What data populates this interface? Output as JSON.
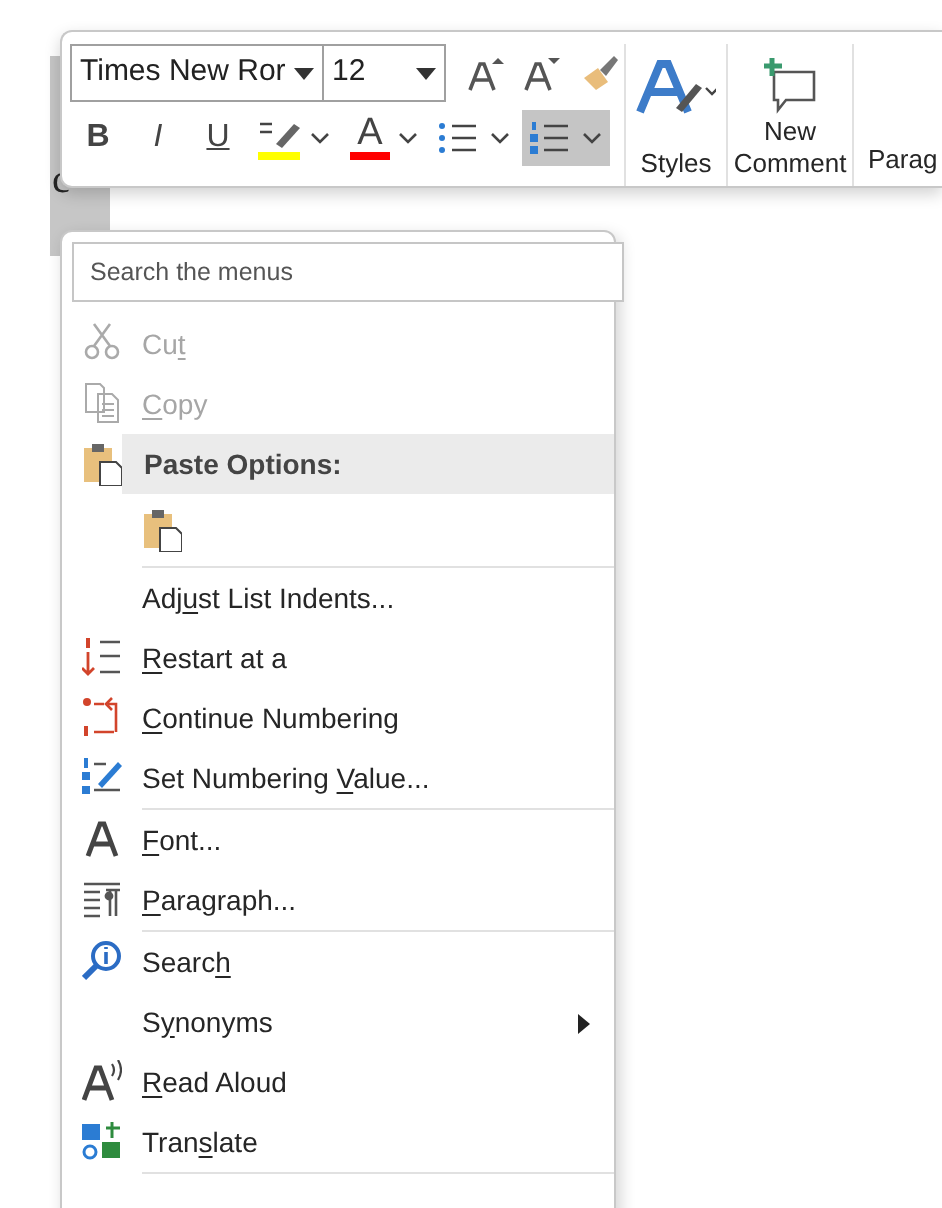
{
  "document": {
    "lines": [
      {
        "selected": true
      },
      {
        "selected": true
      },
      {
        "text": "c",
        "selected": true
      },
      {
        "selected": true
      }
    ]
  },
  "mini_toolbar": {
    "font_name": "Times New Ror",
    "font_size": "12",
    "format_buttons": [
      {
        "kind": "bold",
        "label": "B"
      },
      {
        "kind": "italic",
        "label": "I"
      },
      {
        "kind": "underline",
        "label": "U"
      },
      {
        "kind": "highlight",
        "color": "#ffff00"
      },
      {
        "kind": "font-color",
        "label": "A",
        "color": "#ff0000"
      },
      {
        "kind": "bullets",
        "selected": false
      },
      {
        "kind": "numbering",
        "selected": true
      }
    ],
    "big_buttons": [
      {
        "kind": "styles",
        "label": "Styles"
      },
      {
        "kind": "comment",
        "label": "New\nComment"
      },
      {
        "kind": "paragraph",
        "label": "Parag"
      }
    ]
  },
  "context_menu": {
    "search": {
      "placeholder": "Search the menus"
    },
    "groups": [
      [
        {
          "kind": "item",
          "pre": "Cu",
          "key": "t",
          "disabled": true
        },
        {
          "kind": "item",
          "key": "C",
          "post": "opy",
          "disabled": true
        },
        {
          "kind": "header",
          "label": "Paste Options:"
        },
        {
          "kind": "paste-options"
        }
      ],
      [
        {
          "kind": "item",
          "pre": "Adj",
          "key": "u",
          "post": "st List Indents...",
          "disabled": false
        },
        {
          "kind": "item",
          "key": "R",
          "post": "estart at a",
          "disabled": false
        },
        {
          "kind": "item",
          "key": "C",
          "post": "ontinue Numbering",
          "disabled": false
        },
        {
          "kind": "item",
          "pre": "Set Numbering ",
          "key": "V",
          "post": "alue...",
          "disabled": false
        }
      ],
      [
        {
          "kind": "item",
          "key": "F",
          "post": "ont...",
          "disabled": false
        },
        {
          "kind": "item",
          "key": "P",
          "post": "aragraph...",
          "disabled": false
        }
      ],
      [
        {
          "kind": "item",
          "pre": "Searc",
          "key": "h",
          "disabled": false
        },
        {
          "kind": "submenu",
          "pre": "S",
          "key": "y",
          "post": "nonyms",
          "disabled": false
        },
        {
          "kind": "item",
          "key": "R",
          "post": "ead Aloud",
          "disabled": false
        },
        {
          "kind": "item",
          "pre": "Tran",
          "key": "s",
          "post": "late",
          "disabled": false
        }
      ]
    ]
  }
}
